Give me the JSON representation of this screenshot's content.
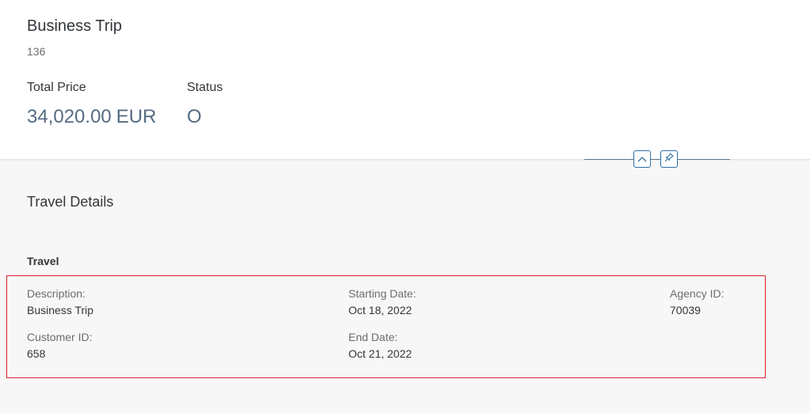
{
  "header": {
    "title": "Business Trip",
    "subtitle": "136",
    "kpis": [
      {
        "label": "Total Price",
        "value": "34,020.00",
        "unit": "EUR"
      },
      {
        "label": "Status",
        "value": "O"
      }
    ]
  },
  "anchor_bar": {
    "collapse_icon": "chevron-up-icon",
    "pin_icon": "pin-icon"
  },
  "section": {
    "title": "Travel Details",
    "group_title": "Travel",
    "fields": [
      {
        "label": "Description:",
        "value": "Business Trip"
      },
      {
        "label": "Customer ID:",
        "value": "658"
      },
      {
        "label": "Starting Date:",
        "value": "Oct 18, 2022"
      },
      {
        "label": "End Date:",
        "value": "Oct 21, 2022"
      },
      {
        "label": "Agency ID:",
        "value": "70039"
      }
    ]
  },
  "colors": {
    "highlight_border": "#e0202a",
    "kpi_value": "#556b82",
    "anchor_accent": "#2e6ea5"
  }
}
